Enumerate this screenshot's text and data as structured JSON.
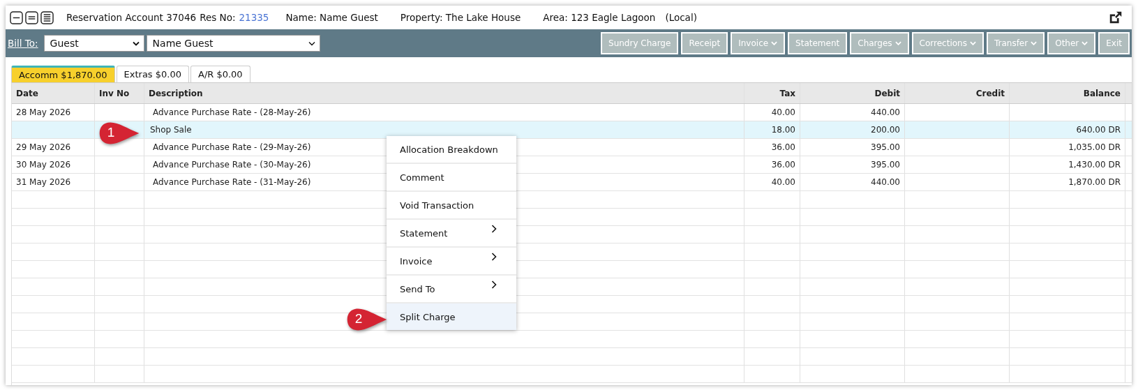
{
  "header": {
    "title": "Reservation Account 37046",
    "res_no_label": "Res No:",
    "res_no": "21335",
    "name": "Name: Name Guest",
    "property": "Property: The Lake House",
    "area": "Area: 123 Eagle Lagoon",
    "local": "(Local)"
  },
  "toolbar": {
    "bill_to_label": "Bill To:",
    "bill_to_type": "Guest",
    "bill_to_name": "Name Guest",
    "buttons": [
      {
        "label": "Sundry Charge",
        "dropdown": false
      },
      {
        "label": "Receipt",
        "dropdown": false
      },
      {
        "label": "Invoice",
        "dropdown": true
      },
      {
        "label": "Statement",
        "dropdown": false
      },
      {
        "label": "Charges",
        "dropdown": true
      },
      {
        "label": "Corrections",
        "dropdown": true
      },
      {
        "label": "Transfer",
        "dropdown": true
      },
      {
        "label": "Other",
        "dropdown": true
      },
      {
        "label": "Exit",
        "dropdown": false
      }
    ]
  },
  "tabs": [
    {
      "label": "Accomm $1,870.00",
      "selected": true
    },
    {
      "label": "Extras $0.00",
      "selected": false
    },
    {
      "label": "A/R $0.00",
      "selected": false
    }
  ],
  "table": {
    "columns": [
      "Date",
      "Inv No",
      "Description",
      "Tax",
      "Debit",
      "Credit",
      "Balance"
    ],
    "rows": [
      {
        "date": "28 May 2026",
        "description": "Advance Purchase Rate  - (28-May-26)",
        "tax": "40.00",
        "debit": "440.00",
        "balance": "",
        "selected": false
      },
      {
        "date": "",
        "description": "Shop Sale",
        "tax": "18.00",
        "debit": "200.00",
        "balance": "640.00 DR",
        "selected": true
      },
      {
        "date": "29 May 2026",
        "description": "Advance Purchase Rate  - (29-May-26)",
        "tax": "36.00",
        "debit": "395.00",
        "balance": "1,035.00 DR",
        "selected": false
      },
      {
        "date": "30 May 2026",
        "description": "Advance Purchase Rate  - (30-May-26)",
        "tax": "36.00",
        "debit": "395.00",
        "balance": "1,430.00 DR",
        "selected": false
      },
      {
        "date": "31 May 2026",
        "description": "Advance Purchase Rate  - (31-May-26)",
        "tax": "40.00",
        "debit": "440.00",
        "balance": "1,870.00 DR",
        "selected": false
      }
    ]
  },
  "context_menu": [
    {
      "label": "Allocation Breakdown",
      "submenu": false,
      "selected": false
    },
    {
      "label": "Comment",
      "submenu": false,
      "selected": false
    },
    {
      "label": "Void Transaction",
      "submenu": false,
      "selected": false
    },
    {
      "label": "Statement",
      "submenu": true,
      "selected": false
    },
    {
      "label": "Invoice",
      "submenu": true,
      "selected": false
    },
    {
      "label": "Send To",
      "submenu": true,
      "selected": false
    },
    {
      "label": "Split Charge",
      "submenu": false,
      "selected": true
    }
  ],
  "callouts": [
    {
      "label": "1"
    },
    {
      "label": "2"
    }
  ]
}
